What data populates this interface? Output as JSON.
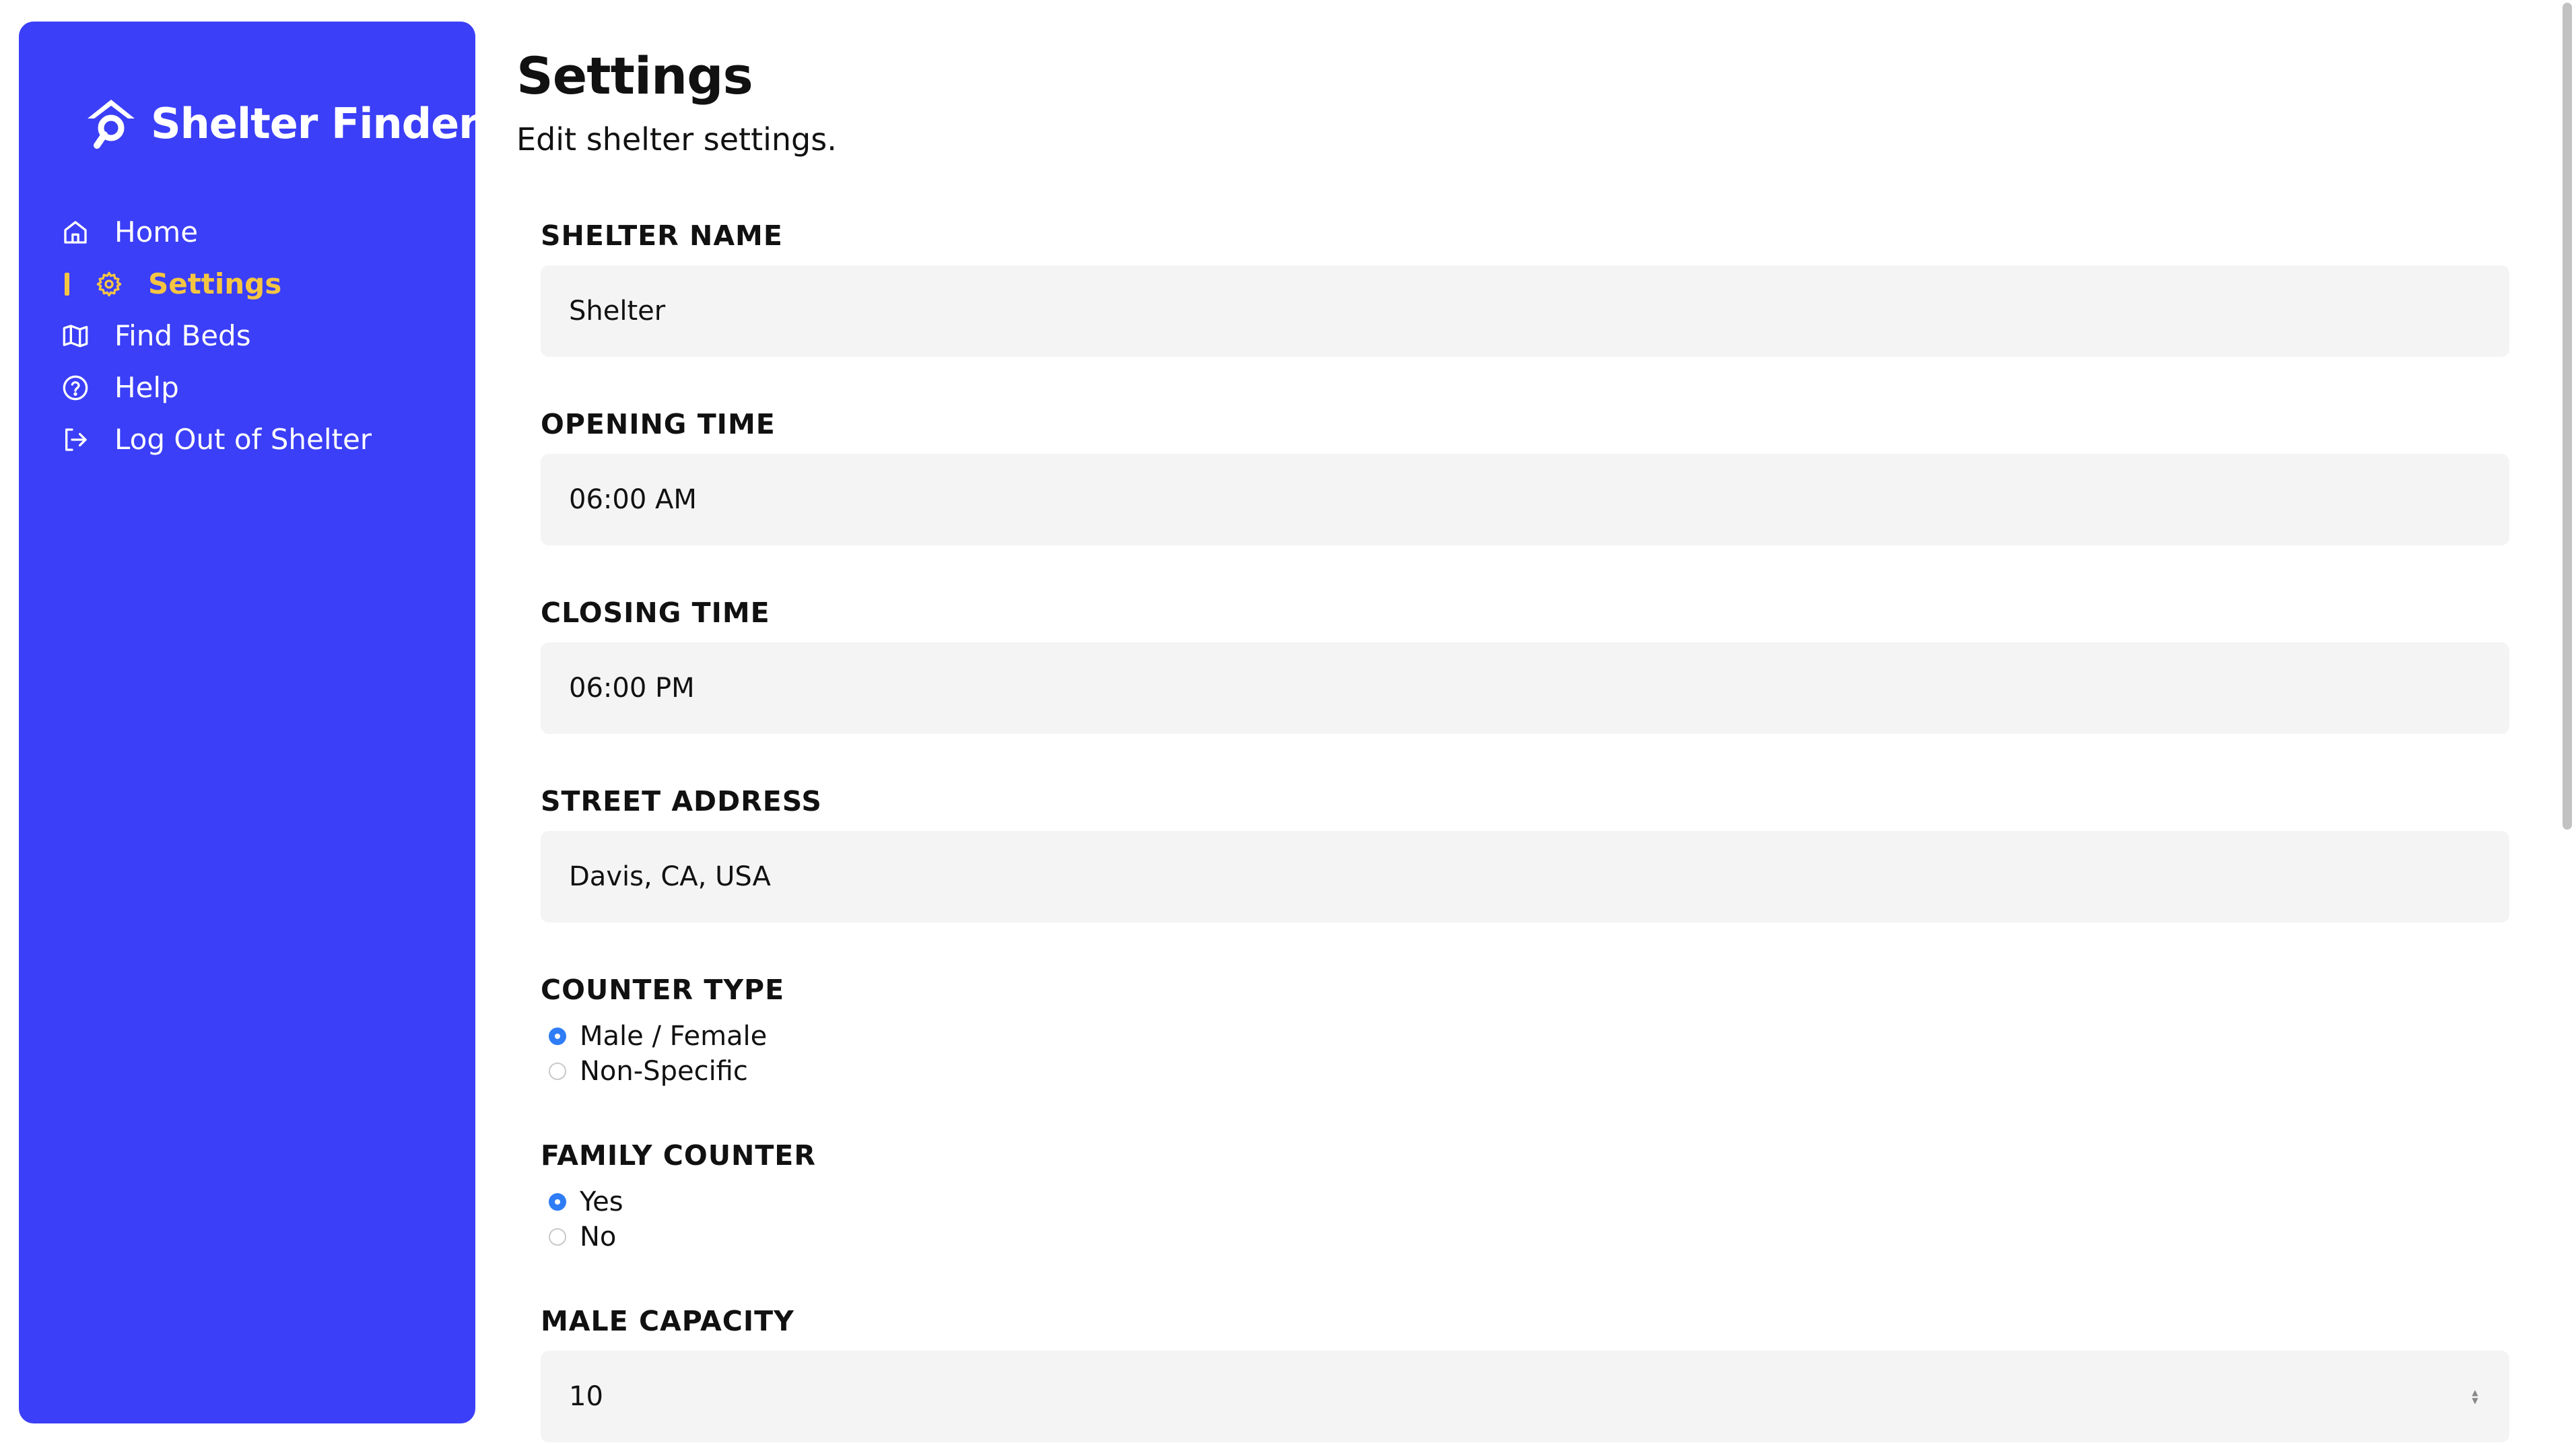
{
  "brand": {
    "name": "Shelter Finder",
    "color": "#3b3ff7",
    "accent": "#f5c542"
  },
  "nav": {
    "items": [
      {
        "label": "Home",
        "icon": "home-icon",
        "active": false
      },
      {
        "label": "Settings",
        "icon": "gear-icon",
        "active": true
      },
      {
        "label": "Find Beds",
        "icon": "map-icon",
        "active": false
      },
      {
        "label": "Help",
        "icon": "help-circle-icon",
        "active": false
      },
      {
        "label": "Log Out of Shelter",
        "icon": "logout-icon",
        "active": false
      }
    ]
  },
  "page": {
    "title": "Settings",
    "subtitle": "Edit shelter settings."
  },
  "form": {
    "shelter_name": {
      "label": "SHELTER NAME",
      "value": "Shelter"
    },
    "opening_time": {
      "label": "OPENING TIME",
      "value": "06:00 AM"
    },
    "closing_time": {
      "label": "CLOSING TIME",
      "value": "06:00 PM"
    },
    "street_address": {
      "label": "STREET ADDRESS",
      "value": "Davis, CA, USA"
    },
    "counter_type": {
      "label": "COUNTER TYPE",
      "options": [
        "Male / Female",
        "Non-Specific"
      ],
      "selected": "Male / Female"
    },
    "family_counter": {
      "label": "FAMILY COUNTER",
      "options": [
        "Yes",
        "No"
      ],
      "selected": "Yes"
    },
    "male_capacity": {
      "label": "MALE CAPACITY",
      "value": "10"
    }
  },
  "colors": {
    "radio_checked": "#2f7df6",
    "field_background": "#f4f4f4"
  }
}
